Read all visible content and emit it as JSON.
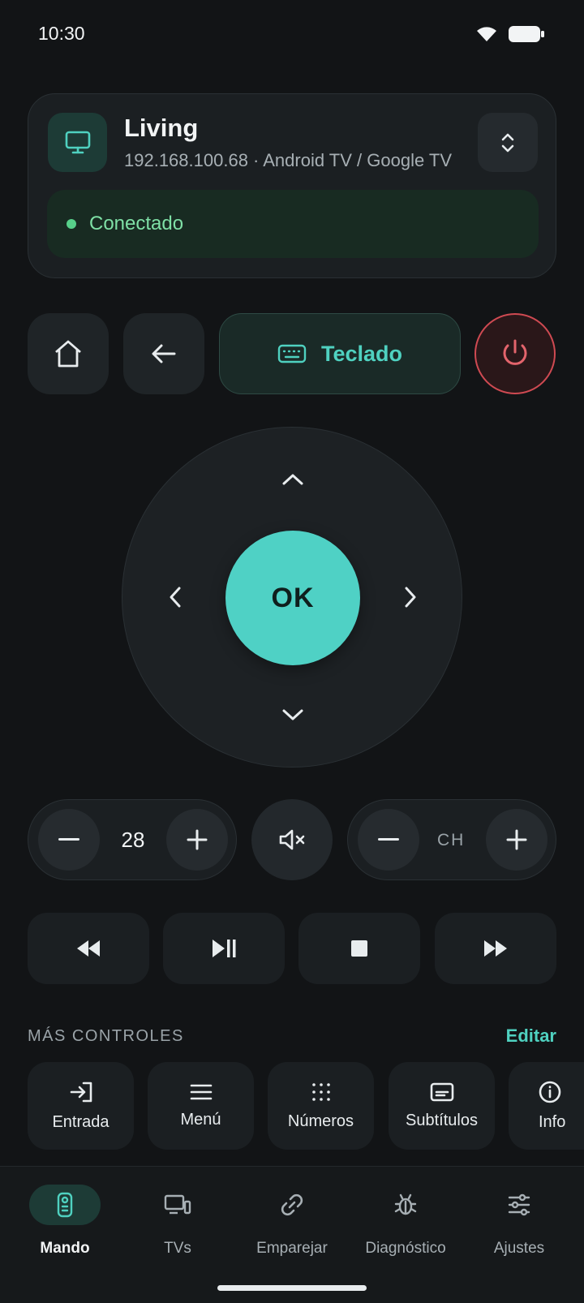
{
  "status_bar": {
    "time": "10:30",
    "wifi_icon": "wifi-icon",
    "battery_icon": "battery-icon"
  },
  "device": {
    "name": "Living",
    "details": "192.168.100.68 · Android TV / Google TV",
    "status": "Conectado",
    "icon": "tv-icon",
    "switch_icon": "unfold-icon"
  },
  "actions": {
    "home_icon": "home-icon",
    "back_icon": "arrow-left-icon",
    "keyboard_label": "Teclado",
    "power_icon": "power-icon"
  },
  "dpad": {
    "ok_label": "OK"
  },
  "volume": {
    "value": "28",
    "mute_icon": "volume-mute-icon"
  },
  "channel": {
    "label": "CH"
  },
  "media": [
    "rewind-icon",
    "play-pause-icon",
    "stop-icon",
    "fast-forward-icon"
  ],
  "more_controls": {
    "title": "MÁS CONTROLES",
    "edit_label": "Editar",
    "items": [
      {
        "label": "Entrada",
        "icon": "input-icon"
      },
      {
        "label": "Menú",
        "icon": "menu-icon"
      },
      {
        "label": "Números",
        "icon": "numpad-icon"
      },
      {
        "label": "Subtítulos",
        "icon": "subtitles-icon"
      },
      {
        "label": "Info",
        "icon": "info-icon"
      }
    ]
  },
  "nav": {
    "items": [
      {
        "label": "Mando",
        "icon": "remote-icon",
        "active": true
      },
      {
        "label": "TVs",
        "icon": "devices-icon",
        "active": false
      },
      {
        "label": "Emparejar",
        "icon": "link-icon",
        "active": false
      },
      {
        "label": "Diagnóstico",
        "icon": "bug-icon",
        "active": false
      },
      {
        "label": "Ajustes",
        "icon": "sliders-icon",
        "active": false
      }
    ]
  },
  "colors": {
    "accent": "#4fd1c5",
    "background": "#121416",
    "connected": "#57d08a",
    "power": "#cf4a52"
  }
}
